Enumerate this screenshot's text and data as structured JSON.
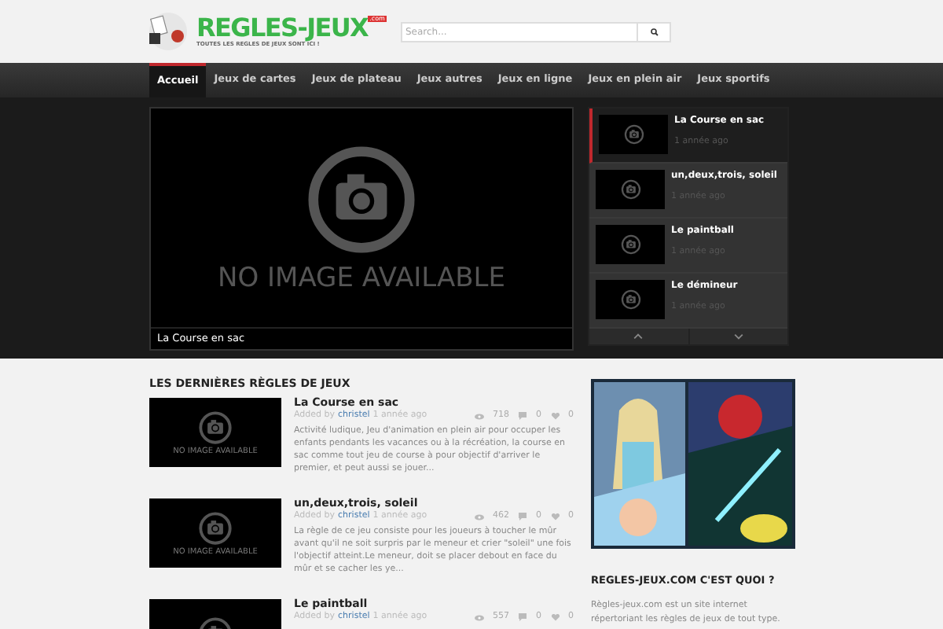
{
  "logo": {
    "name": "REGLES-JEUX",
    "suffix": ".com",
    "tagline": "TOUTES LES REGLES DE JEUX SONT ICI !"
  },
  "search": {
    "placeholder": "Search..."
  },
  "nav": [
    {
      "label": "Accueil",
      "selected": true
    },
    {
      "label": "Jeux de cartes",
      "selected": false
    },
    {
      "label": "Jeux de plateau",
      "selected": false
    },
    {
      "label": "Jeux autres",
      "selected": false
    },
    {
      "label": "Jeux en ligne",
      "selected": false
    },
    {
      "label": "Jeux en plein air",
      "selected": false
    },
    {
      "label": "Jeux sportifs",
      "selected": false
    }
  ],
  "featured": {
    "image_text": "NO IMAGE AVAILABLE",
    "caption": "La Course en sac"
  },
  "slider": [
    {
      "title": "La Course en sac",
      "time": "1 année ago",
      "selected": true
    },
    {
      "title": "un,deux,trois, soleil",
      "time": "1 année ago",
      "selected": false
    },
    {
      "title": "Le paintball",
      "time": "1 année ago",
      "selected": false
    },
    {
      "title": "Le démineur",
      "time": "1 année ago",
      "selected": false
    }
  ],
  "latest": {
    "heading": "LES DERNIÈRES RÈGLES DE JEUX",
    "posts": [
      {
        "title": "La Course en sac",
        "added_by": "Added by",
        "author": "christel",
        "time": "1 année ago",
        "views": "718",
        "comments": "0",
        "likes": "0",
        "image_text": "NO IMAGE AVAILABLE",
        "excerpt": "Activité ludique, Jeu d'animation en plein air pour occuper les enfants pendants les vacances ou à la récréation, la course en sac comme tout jeu de course à pour objectif  d'arriver le premier, et peut aussi se jouer..."
      },
      {
        "title": "un,deux,trois, soleil",
        "added_by": "Added by",
        "author": "christel",
        "time": "1 année ago",
        "views": "462",
        "comments": "0",
        "likes": "0",
        "image_text": "NO IMAGE AVAILABLE",
        "excerpt": "La règle de ce jeu consiste pour les joueurs à toucher le mûr avant qu'il ne soit surpris par le meneur et crier \"soleil\" une fois l'objectif atteint.Le meneur, doit se placer debout en face du mûr et se cacher les ye..."
      },
      {
        "title": "Le paintball",
        "added_by": "Added by",
        "author": "christel",
        "time": "1 année ago",
        "views": "557",
        "comments": "0",
        "likes": "0"
      }
    ]
  },
  "about": {
    "heading": "REGLES-JEUX.COM C'EST QUOI ?",
    "text": "Règles-jeux.com est un site internet répertoriant les règles de jeux de tout type."
  }
}
